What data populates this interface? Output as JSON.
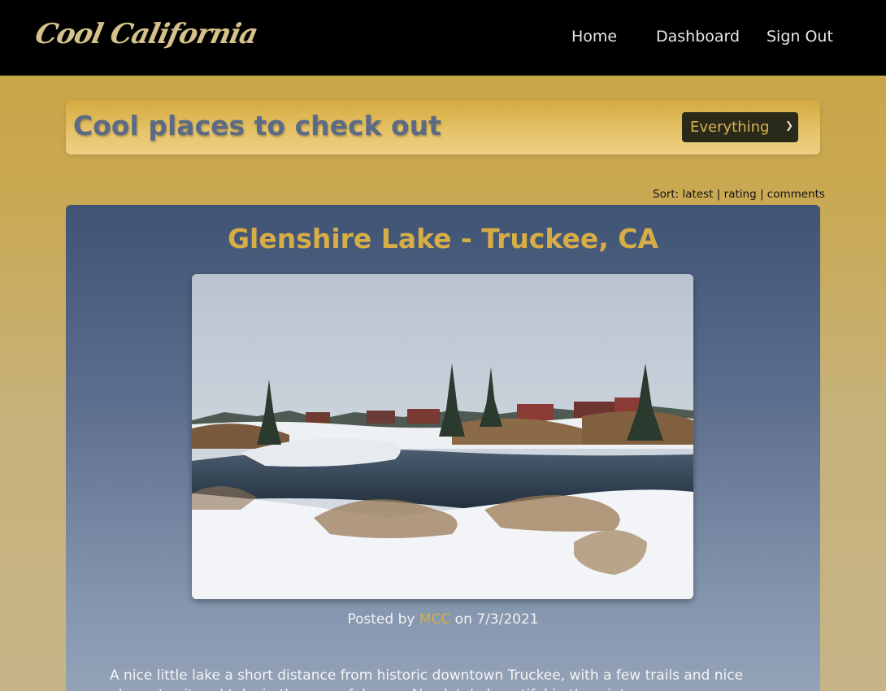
{
  "nav": {
    "logo": "Cool California",
    "links": [
      "Home",
      "Dashboard",
      "Sign Out"
    ]
  },
  "header": {
    "title": "Cool places to check out",
    "filter": {
      "selected": "Everything"
    }
  },
  "sort": {
    "prefix": "Sort:",
    "options": [
      "latest",
      "rating",
      "comments"
    ],
    "separator": "|"
  },
  "post": {
    "title": "Glenshire Lake - Truckee, CA",
    "posted_by_label": "Posted by",
    "author": "MCC",
    "on_label": "on",
    "date": "7/3/2021",
    "body": "A nice little lake a short distance from historic downtown Truckee, with a few trails and nice places to sit and take in the peaceful area. Absolutely beautiful in the winter."
  }
}
